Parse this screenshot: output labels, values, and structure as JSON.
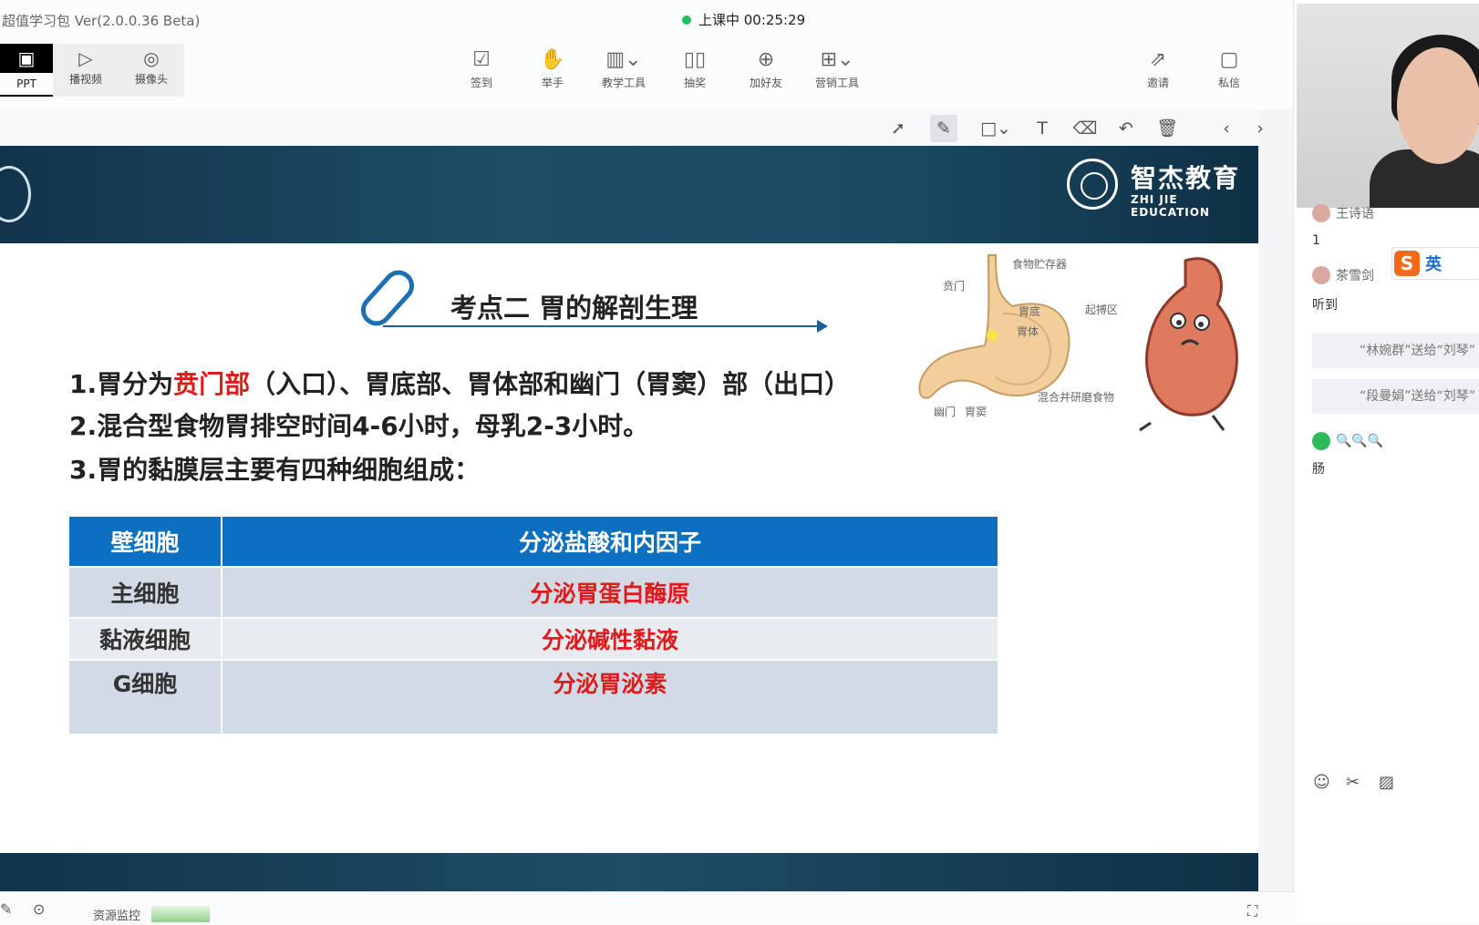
{
  "app": {
    "title": "超值学习包 Ver(2.0.0.36 Beta)",
    "status": "上课中 00:25:29"
  },
  "left_tools": [
    {
      "label": "PPT",
      "icon": "ppt-icon"
    },
    {
      "label": "播视频",
      "icon": "play-video-icon"
    },
    {
      "label": "摄像头",
      "icon": "camera-icon"
    }
  ],
  "toolbar": [
    {
      "label": "签到",
      "icon": "checkin-icon"
    },
    {
      "label": "举手",
      "icon": "hand-icon"
    },
    {
      "label": "教学工具",
      "icon": "teaching-tools-icon"
    },
    {
      "label": "抽奖",
      "icon": "lottery-icon"
    },
    {
      "label": "加好友",
      "icon": "add-friend-icon"
    },
    {
      "label": "营销工具",
      "icon": "marketing-tools-icon"
    },
    {
      "label": "邀请",
      "icon": "invite-icon"
    },
    {
      "label": "私信",
      "icon": "private-message-icon"
    }
  ],
  "slide": {
    "logo_cn": "智杰教育",
    "logo_en": "ZHI JIE EDUCATION",
    "title": "考点二  胃的解剖生理",
    "point1_pre": "1.胃分为",
    "point1_hl": "贲门部",
    "point1_post": "（入口）、胃底部、胃体部和幽门（胃窦）部（出口）",
    "point2": "2.混合型食物胃排空时间4-6小时，母乳2-3小时。",
    "point3": "3.胃的黏膜层主要有四种细胞组成：",
    "table": [
      {
        "cell": "壁细胞",
        "function": "分泌盐酸和内因子"
      },
      {
        "cell": "主细胞",
        "function": "分泌胃蛋白酶原"
      },
      {
        "cell": "黏液细胞",
        "function": "分泌碱性黏液"
      },
      {
        "cell": "G细胞",
        "function": "分泌胃泌素"
      }
    ],
    "illustration_labels": {
      "food": "食物贮存器",
      "cardia": "贲门",
      "fundus": "胃底",
      "body": "胃体",
      "pacemaker": "起搏区",
      "pylorus": "幽门",
      "antrum": "胃窦",
      "mix": "混合并研磨食物"
    }
  },
  "chat": {
    "user1": "王诗语",
    "msg1": "1",
    "user2": "茶雪剑",
    "msg2": "听到",
    "gift1": "“林婉群”送给“刘琴”",
    "gift2": "“段曼娟”送给“刘琴”",
    "emoji_msg": "🔍🔍🔍",
    "msg3": "肠",
    "ime_lang": "英"
  },
  "status_bar": {
    "resource_monitor": "资源监控"
  },
  "colors": {
    "slide_header": "#1e4d66",
    "highlight_red": "#e01b1b",
    "table_header": "#0d6fbf",
    "live_dot": "#22c05a"
  }
}
